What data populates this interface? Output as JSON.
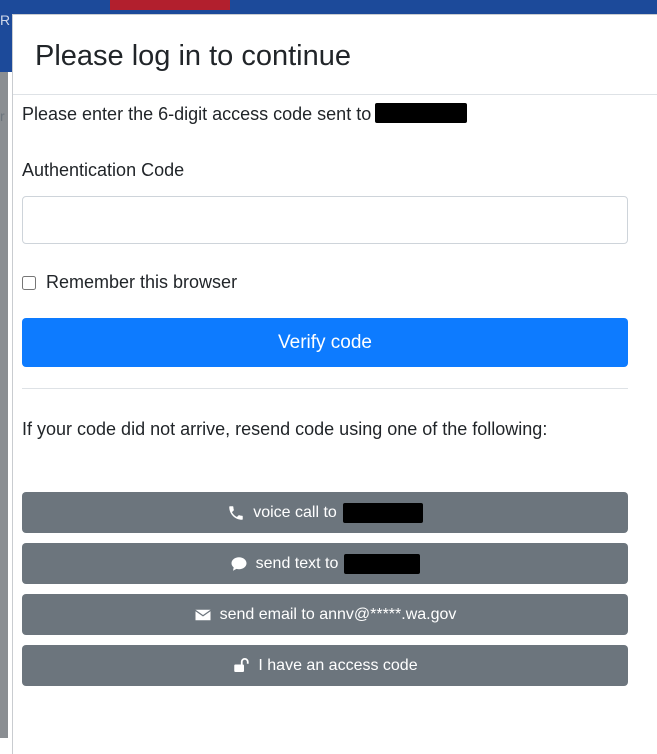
{
  "background": {
    "header_color": "#1c4a9a",
    "accent_color": "#b21f2d",
    "fragment_top": "R",
    "fragment_side": "r"
  },
  "modal": {
    "title": "Please log in to continue",
    "intro_text": "Please enter the 6-digit access code sent to",
    "auth_label": "Authentication Code",
    "auth_input": {
      "value": "",
      "placeholder": ""
    },
    "remember_label": "Remember this browser",
    "remember_checked": false,
    "verify_label": "Verify code",
    "resend_text": "If your code did not arrive, resend code using one of the following:",
    "buttons": {
      "voice": {
        "label": "voice call to",
        "icon": "phone-icon"
      },
      "text": {
        "label": "send text to",
        "icon": "chat-bubble-icon"
      },
      "email": {
        "label": "send email to annv@*****.wa.gov",
        "icon": "envelope-icon"
      },
      "access": {
        "label": "I have an access code",
        "icon": "unlock-icon"
      }
    },
    "colors": {
      "primary": "#0d7bff",
      "secondary": "#6c757d",
      "redaction": "#000000"
    }
  }
}
